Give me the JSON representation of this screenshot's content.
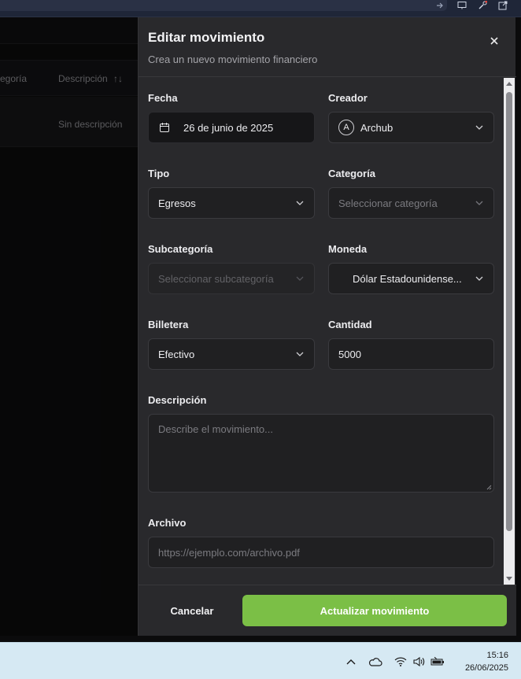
{
  "colors": {
    "accent": "#7bbf46",
    "panel": "#29292c",
    "taskbar": "#d6e9f3"
  },
  "browser": {
    "icons": [
      "arrow-icon",
      "monitor-icon",
      "wrench-icon",
      "external-link-icon"
    ]
  },
  "background": {
    "table_headers": {
      "category_partial": "egoría",
      "description": "Descripción",
      "sort_icon": "↑↓"
    },
    "row": {
      "description": "Sin descripción"
    }
  },
  "dialog": {
    "title": "Editar movimiento",
    "subtitle": "Crea un nuevo movimiento financiero",
    "close_icon": "close-icon",
    "fields": {
      "fecha": {
        "label": "Fecha",
        "value": "26 de junio de 2025"
      },
      "creador": {
        "label": "Creador",
        "avatar": "A",
        "value": "Archub"
      },
      "tipo": {
        "label": "Tipo",
        "value": "Egresos"
      },
      "categoria": {
        "label": "Categoría",
        "placeholder": "Seleccionar categoría"
      },
      "subcategoria": {
        "label": "Subcategoría",
        "placeholder": "Seleccionar subcategoría"
      },
      "moneda": {
        "label": "Moneda",
        "value": "Dólar Estadounidense..."
      },
      "billetera": {
        "label": "Billetera",
        "value": "Efectivo"
      },
      "cantidad": {
        "label": "Cantidad",
        "value": "5000"
      },
      "descripcion": {
        "label": "Descripción",
        "placeholder": "Describe el movimiento..."
      },
      "archivo": {
        "label": "Archivo",
        "placeholder": "https://ejemplo.com/archivo.pdf"
      }
    },
    "footer": {
      "cancel": "Cancelar",
      "submit": "Actualizar movimiento"
    }
  },
  "taskbar": {
    "time": "15:16",
    "date": "26/06/2025",
    "icons": [
      "chevron-up-icon",
      "cloud-icon",
      "wifi-icon",
      "volume-icon",
      "battery-icon"
    ]
  }
}
